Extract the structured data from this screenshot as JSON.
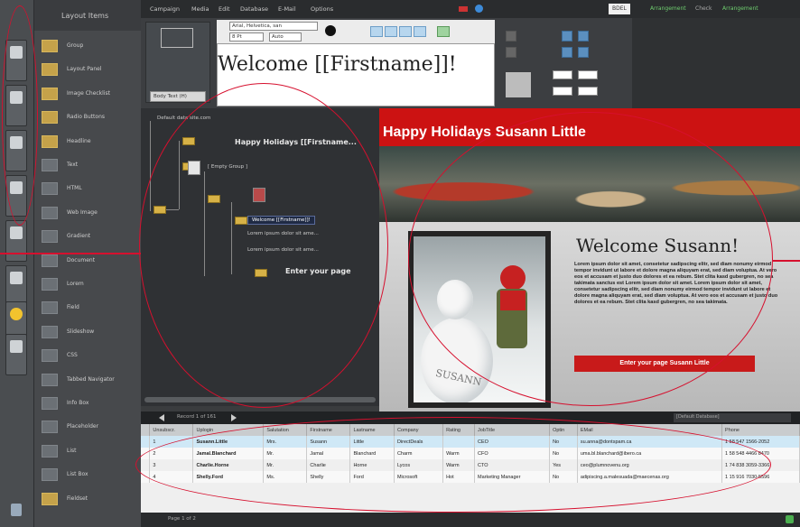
{
  "sidebar": {
    "title": "Layout Items",
    "items": [
      {
        "label": "Group"
      },
      {
        "label": "Layout Panel"
      },
      {
        "label": "Image Checklist"
      },
      {
        "label": "Radio Buttons"
      },
      {
        "label": "Headline"
      },
      {
        "label": "Text"
      },
      {
        "label": "HTML"
      },
      {
        "label": "Web Image"
      },
      {
        "label": "Gradient"
      },
      {
        "label": "Document"
      },
      {
        "label": "Lorem"
      },
      {
        "label": "Field"
      },
      {
        "label": "Slideshow"
      },
      {
        "label": "CSS"
      },
      {
        "label": "Tabbed Navigator"
      },
      {
        "label": "Info Box"
      },
      {
        "label": "Placeholder"
      },
      {
        "label": "List"
      },
      {
        "label": "List Box"
      },
      {
        "label": "Fieldset"
      }
    ]
  },
  "menubar": {
    "items": [
      "Campaign",
      "Media",
      "Edit",
      "Database",
      "E-Mail",
      "Options"
    ],
    "right_tabs": [
      "BDEL",
      "",
      "Arrangement",
      "Check",
      "Arrangement"
    ]
  },
  "toolbar": {
    "font": "Arial, Helvetica, san",
    "size": "8 Pt",
    "size2": "Auto",
    "style_select": "Body Text (H)",
    "editor_text": "Welcome [[Firstname]]!"
  },
  "tree": {
    "root_label": "Default data site.com",
    "nodes": [
      {
        "label": "Happy Holidays [[Firstname..."
      },
      {
        "label": "[ Empty Group ]"
      },
      {
        "label": "Welcome [[Firstname]]!"
      },
      {
        "label": "Lorem ipsum dolor sit ame..."
      },
      {
        "label": "Lorem ipsum dolor sit ame..."
      },
      {
        "label": "Enter your page"
      }
    ]
  },
  "preview": {
    "title": "Happy Holidays Susann Little",
    "heading": "Welcome Susann!",
    "body": "Lorem ipsum dolor sit amet, consetetur sadipscing elitr, sed diam nonumy eirmod tempor invidunt ut labore et dolore magna aliquyam erat, sed diam voluptua. At vero eos et accusam et justo duo dolores et ea rebum. Stet clita kasd gubergren, no sea takimata sanctus est Lorem ipsum dolor sit amet. Lorem ipsum dolor sit amet, consetetur sadipscing elitr, sed diam nonumy eirmod tempor invidunt ut labore et dolore magna aliquyam erat, sed diam voluptua. At vero eos et accusam et justo duo dolores et ea rebum. Stet clita kasd gubergren, no sea takimata.",
    "button": "Enter your page Susann Little",
    "photo_caption": "SUSANN"
  },
  "nav": {
    "record_text": "Record 1 of 161",
    "search_placeholder": "[Default Database]"
  },
  "grid": {
    "headers": [
      "",
      "Unsubscr.",
      "Uplogin",
      "Salutation",
      "Firstname",
      "Lastname",
      "Company",
      "Rating",
      "JobTitle",
      "Optin",
      "EMail",
      "Phone"
    ],
    "rows": [
      [
        "",
        "1",
        "Susann.Little",
        "Mrs.",
        "Susann",
        "Little",
        "DirectDeals",
        "",
        "CEO",
        "No",
        "su.anna@dontspam.ca",
        "1 58 547 1566-2052"
      ],
      [
        "",
        "2",
        "Jamal.Blanchard",
        "Mr.",
        "Jamal",
        "Blanchard",
        "Charm",
        "Warm",
        "CFO",
        "No",
        "uma.bl.blanchard@ibero.ca",
        "1 58 548 4466 8470"
      ],
      [
        "",
        "3",
        "Charlie.Horne",
        "Mr.",
        "Charlie",
        "Horne",
        "Lycos",
        "Warm",
        "CTO",
        "Yes",
        "ceo@plumnovenu.org",
        "1 74 838 3059-3366"
      ],
      [
        "",
        "4",
        "Shelly.Ford",
        "Ms.",
        "Shelly",
        "Ford",
        "Microsoft",
        "Hot",
        "Marketing Manager",
        "No",
        "adipiscing.a.malesuada@maecenas.org",
        "1 15 916 7030-5596"
      ]
    ]
  },
  "footer": {
    "page_text": "Page 1 of 2"
  },
  "colors": {
    "accent_red": "#cc1212",
    "annotation": "#d6102e",
    "selection_blue": "#cfe8f6"
  }
}
